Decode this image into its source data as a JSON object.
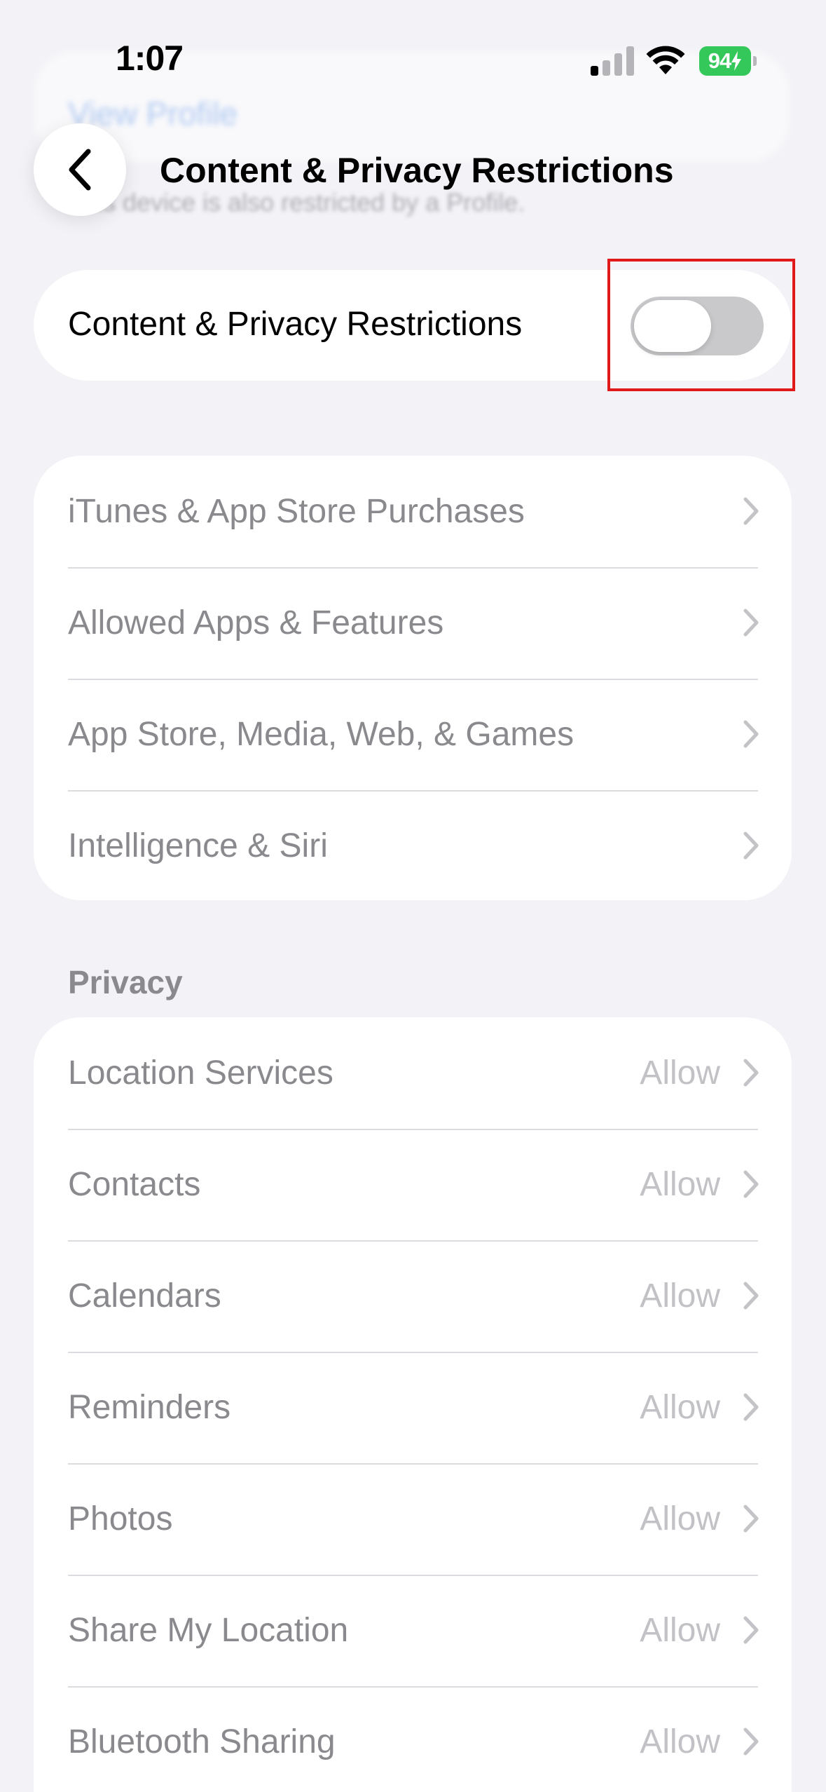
{
  "status_bar": {
    "time": "1:07",
    "battery_percent": "94",
    "signal_bars_active": 1,
    "signal_bars_total": 4,
    "charging": true
  },
  "background": {
    "ghost_link": "View Profile",
    "ghost_footnote": "This device is also restricted by a Profile."
  },
  "nav": {
    "title": "Content & Privacy Restrictions",
    "back_icon": "chevron-left-icon"
  },
  "main_toggle": {
    "label": "Content & Privacy Restrictions",
    "on": false
  },
  "restrictions": {
    "items": [
      {
        "label": "iTunes & App Store Purchases"
      },
      {
        "label": "Allowed Apps & Features"
      },
      {
        "label": "App Store, Media, Web, & Games"
      },
      {
        "label": "Intelligence & Siri"
      }
    ]
  },
  "privacy": {
    "header": "Privacy",
    "items": [
      {
        "label": "Location Services",
        "value": "Allow"
      },
      {
        "label": "Contacts",
        "value": "Allow"
      },
      {
        "label": "Calendars",
        "value": "Allow"
      },
      {
        "label": "Reminders",
        "value": "Allow"
      },
      {
        "label": "Photos",
        "value": "Allow"
      },
      {
        "label": "Share My Location",
        "value": "Allow"
      },
      {
        "label": "Bluetooth Sharing",
        "value": "Allow"
      }
    ]
  },
  "colors": {
    "background": "#f2f2f7",
    "battery": "#34c759",
    "switch_off": "#c9c9cc",
    "highlight": "#e0191b"
  }
}
